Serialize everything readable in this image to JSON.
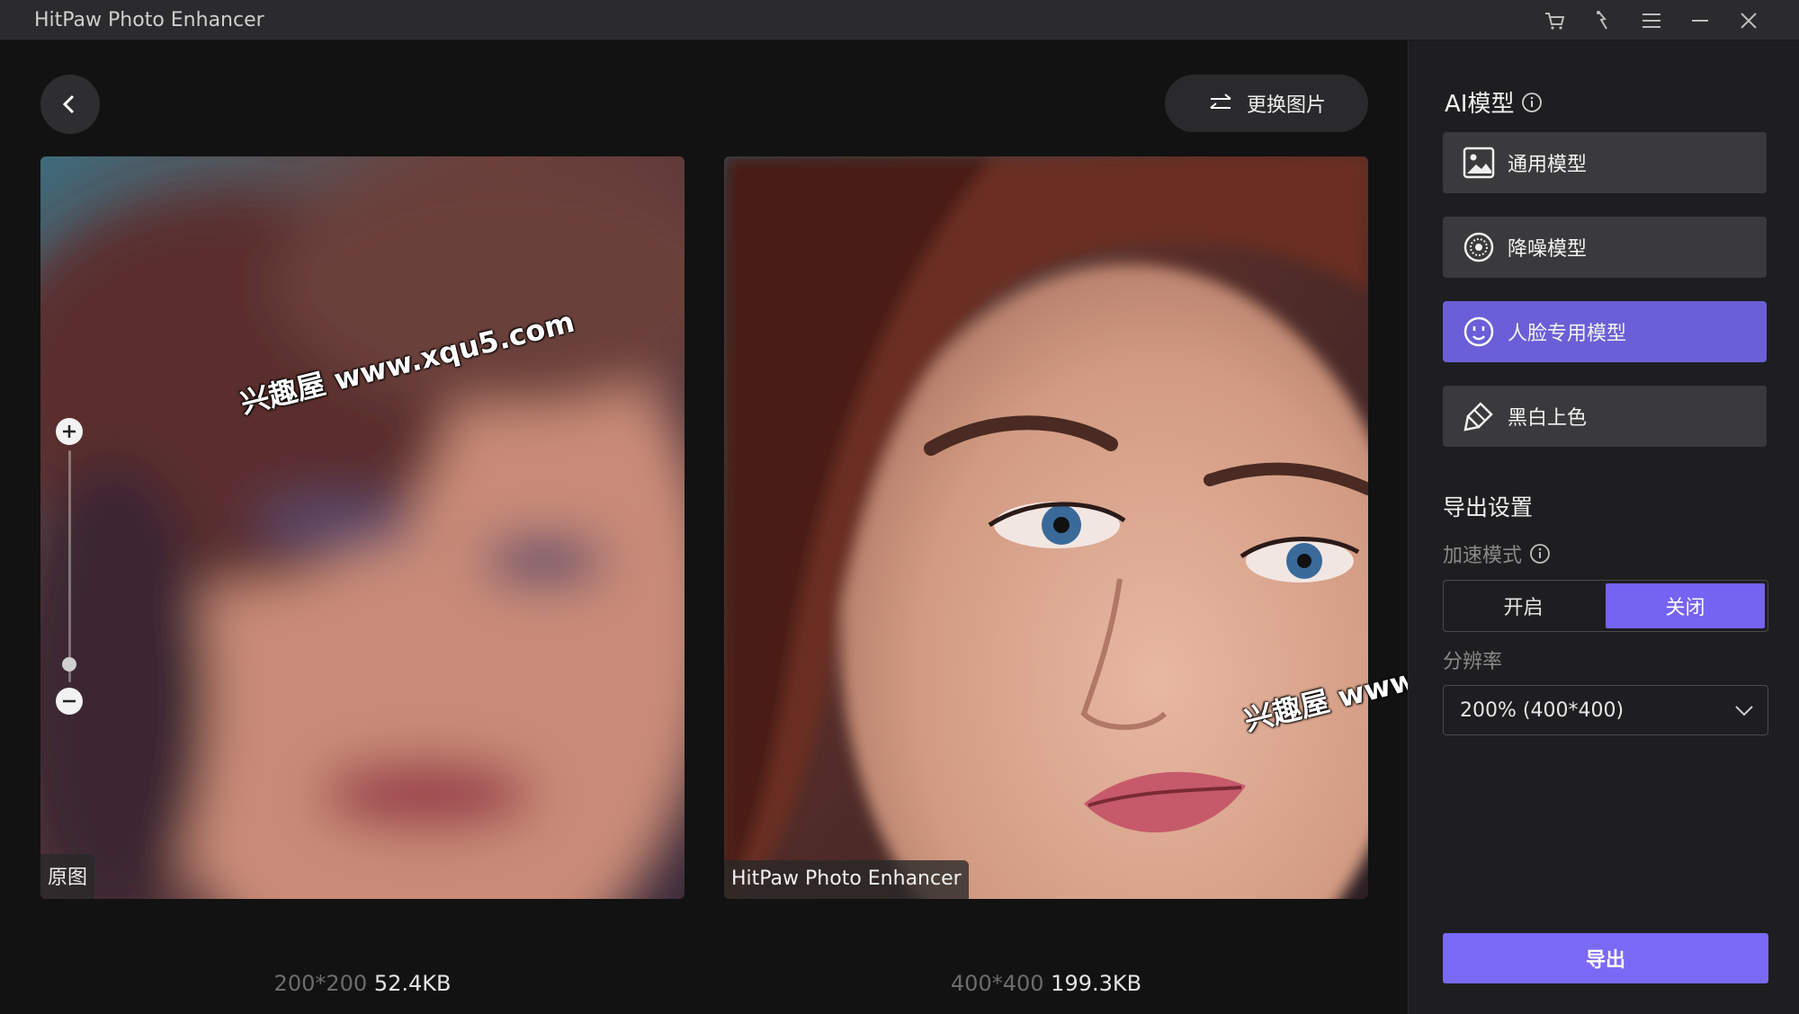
{
  "window": {
    "title": "HitPaw Photo Enhancer",
    "controls": [
      "cart-icon",
      "bulb-icon",
      "menu-icon",
      "minimize-icon",
      "close-icon"
    ]
  },
  "toolbar": {
    "replace_label": "更换图片"
  },
  "preview": {
    "original_label": "原图",
    "enhanced_label": "HitPaw Photo Enhancer",
    "original_dims": "200*200",
    "original_size": "52.4KB",
    "enhanced_dims": "400*400",
    "enhanced_size": "199.3KB"
  },
  "watermark": {
    "text": "兴趣屋 www.xqu5.com"
  },
  "panel": {
    "ai_model_title": "AI模型",
    "models": [
      {
        "label": "通用模型",
        "icon": "image-icon",
        "active": false
      },
      {
        "label": "降噪模型",
        "icon": "denoise-icon",
        "active": false
      },
      {
        "label": "人脸专用模型",
        "icon": "face-icon",
        "active": true
      },
      {
        "label": "黑白上色",
        "icon": "colorize-icon",
        "active": false
      }
    ],
    "export_settings_title": "导出设置",
    "accel_label": "加速模式",
    "accel_on": "开启",
    "accel_off": "关闭",
    "accel_selected": "关闭",
    "resolution_label": "分辨率",
    "resolution_value": "200% (400*400)",
    "export_label": "导出"
  },
  "colors": {
    "accent": "#7a69f5",
    "active_model": "#6a5fd6",
    "panel_bg": "#1e1e20"
  }
}
